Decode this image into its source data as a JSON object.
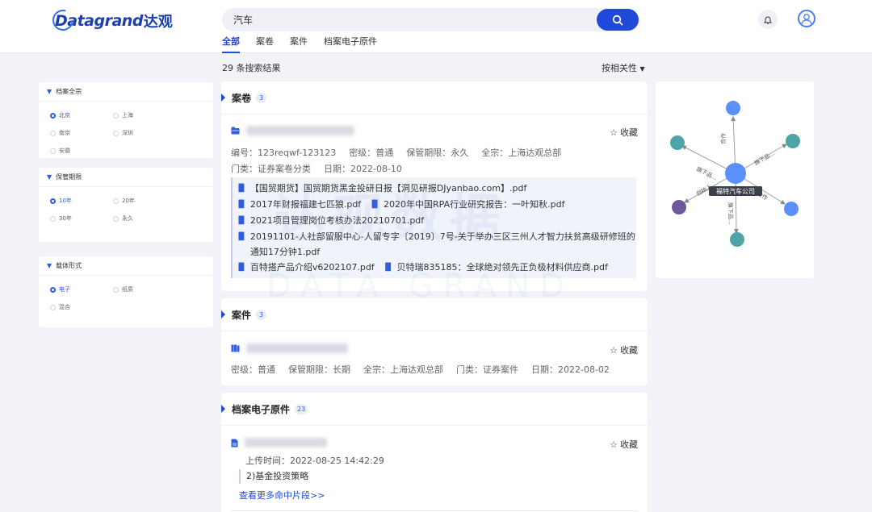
{
  "brand": {
    "name_latin": "Datagrand",
    "name_cn": "达观"
  },
  "search": {
    "value": "汽车"
  },
  "tabs": [
    {
      "label": "全部"
    },
    {
      "label": "案卷"
    },
    {
      "label": "案件"
    },
    {
      "label": "档案电子原件"
    }
  ],
  "results": {
    "summary": "29 条搜索结果",
    "sort_label": "按相关性"
  },
  "filters": [
    {
      "title": "档案全宗",
      "options": [
        "北京",
        "上海",
        "南京",
        "深圳",
        "安徽"
      ],
      "selected": 0
    },
    {
      "title": "保管期限",
      "options": [
        "10年",
        "20年",
        "30年",
        "永久"
      ],
      "selected": 0
    },
    {
      "title": "载体形式",
      "options": [
        "电子",
        "纸质",
        "混合"
      ],
      "selected": 0
    }
  ],
  "fav_label": "收藏",
  "sections": {
    "dossier": {
      "title": "案卷",
      "count": "3",
      "meta1": [
        "编号：123reqwf-123123",
        "密级：普通",
        "保管期限：永久",
        "全宗：上海达观总部"
      ],
      "meta2": [
        "门类：证券案卷分类",
        "日期：2022-08-10"
      ],
      "files": [
        "【国贸期货】国贸期货黑金投研日报【洞见研报DJyanbao.com】.pdf",
        "2017年财报福建七匹狼.pdf",
        "2020年中国RPA行业研究报告：一叶知秋.pdf",
        "2021项目管理岗位考核办法20210701.pdf",
        "20191101-人社部留服中心-人留专字〔2019〕7号-关于举办三区三州人才智力扶贫高级研修班的通知17分钟1.pdf",
        "百特搭产品介绍v6202107.pdf",
        "贝特瑞835185：全球绝对领先正负极材料供应商.pdf"
      ]
    },
    "case": {
      "title": "案件",
      "count": "3",
      "meta": [
        "密级：普通",
        "保管期限：长期",
        "全宗：上海达观总部",
        "门类：证券案件",
        "日期：2022-08-02"
      ]
    },
    "original": {
      "title": "档案电子原件",
      "count": "23",
      "upload_time": "上传时间：2022-08-25 14:42:29",
      "snippet": "2)基金投资策略",
      "more_link": "查看更多命中片段>>"
    }
  },
  "graph": {
    "center": "福特汽车公司",
    "edge_labels": [
      "合作",
      "旗下品...",
      "旗下品...",
      "创始人",
      "旗下品...",
      "合作"
    ],
    "colors": {
      "blue": "#5b8ff9",
      "teal": "#4fa4a8",
      "purple": "#6a5a9c"
    }
  },
  "watermark": {
    "cn": "达观数据",
    "en": "DATA GRAND"
  }
}
